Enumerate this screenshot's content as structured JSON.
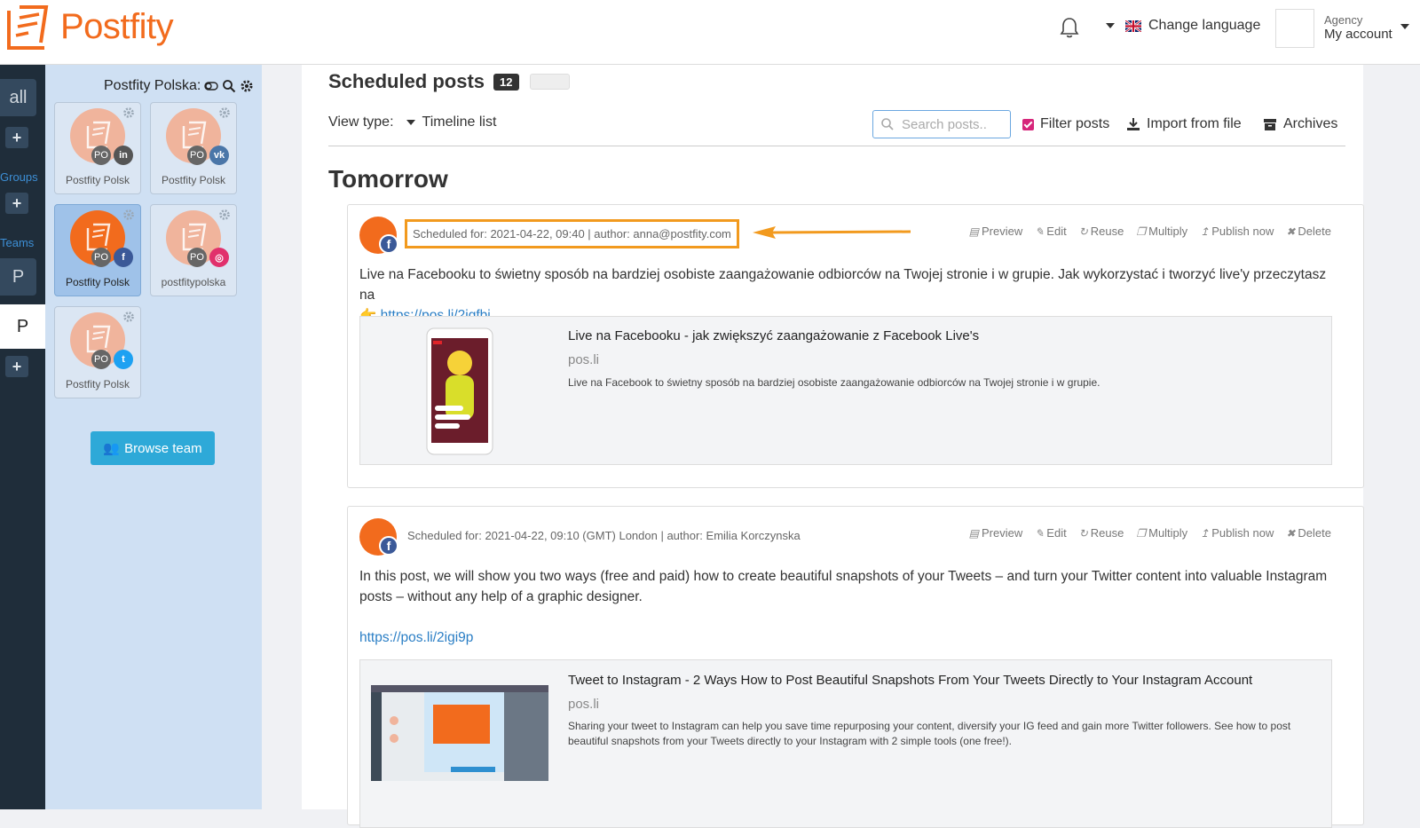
{
  "app": {
    "brand_name": "Postfity",
    "brand_color": "#f26b1d"
  },
  "header": {
    "change_language": "Change language",
    "account_role": "Agency",
    "account_label": "My account"
  },
  "darkbar": {
    "all_label": "all",
    "groups_label": "Groups",
    "teams_label": "Teams",
    "team_letter": "P",
    "active_letter": "P"
  },
  "panel": {
    "title": "Postfity Polska:",
    "browse_button": "Browse team",
    "profiles": [
      {
        "name": "Postfity Polsk",
        "badge": "PO",
        "network": "linkedin",
        "network_glyph": "in",
        "network_color": "#555"
      },
      {
        "name": "Postfity Polsk",
        "badge": "PO",
        "network": "vk",
        "network_glyph": "vk",
        "network_color": "#4a76a8"
      },
      {
        "name": "Postfity Polsk",
        "badge": "PO",
        "network": "facebook",
        "network_glyph": "f",
        "network_color": "#3b5998",
        "selected": true
      },
      {
        "name": "postfitypolska",
        "badge": "PO",
        "network": "instagram",
        "network_glyph": "◎",
        "network_color": "#e1306c"
      },
      {
        "name": "Postfity Polsk",
        "badge": "PO",
        "network": "twitter",
        "network_glyph": "t",
        "network_color": "#1da1f2"
      }
    ]
  },
  "main": {
    "title": "Scheduled posts",
    "count": "12",
    "view_type_label": "View type:",
    "view_type_value": "Timeline list",
    "search_placeholder": "Search posts..",
    "filter_posts": "Filter posts",
    "import_from_file": "Import from file",
    "archives": "Archives",
    "section_title": "Tomorrow",
    "actions": {
      "preview": "Preview",
      "edit": "Edit",
      "reuse": "Reuse",
      "multiply": "Multiply",
      "publish_now": "Publish now",
      "delete": "Delete"
    },
    "posts": [
      {
        "meta": "Scheduled for: 2021-04-22, 09:40 | author: anna@postfity.com",
        "text": "Live na Facebooku to świetny sposób na bardziej osobiste zaangażowanie odbiorców na Twojej stronie i w grupie. Jak wykorzystać i tworzyć live'y przeczytasz na",
        "emoji": "👉",
        "link": "https://pos.li/2igfbi",
        "preview_title": "Live na Facebooku - jak zwiększyć zaangażowanie z Facebook Live's",
        "preview_domain": "pos.li",
        "preview_desc": "Live na Facebook to świetny sposób na bardziej osobiste zaangażowanie odbiorców na Twojej stronie i w grupie."
      },
      {
        "meta": "Scheduled for: 2021-04-22, 09:10 (GMT) London | author: Emilia Korczynska",
        "text": "In this post, we will show you two ways (free and paid) how to create beautiful snapshots of your Tweets – and turn your Twitter content into valuable Instagram posts – without any help of a graphic designer.",
        "link": "https://pos.li/2igi9p",
        "preview_title": "Tweet to Instagram - 2 Ways How to Post Beautiful Snapshots From Your Tweets Directly to Your Instagram Account",
        "preview_domain": "pos.li",
        "preview_desc": "Sharing your tweet to Instagram can help you save time repurposing your content, diversify your IG feed and gain more Twitter followers. See how to post beautiful snapshots from your Tweets directly to your Instagram with 2 simple tools (one free!)."
      }
    ]
  }
}
